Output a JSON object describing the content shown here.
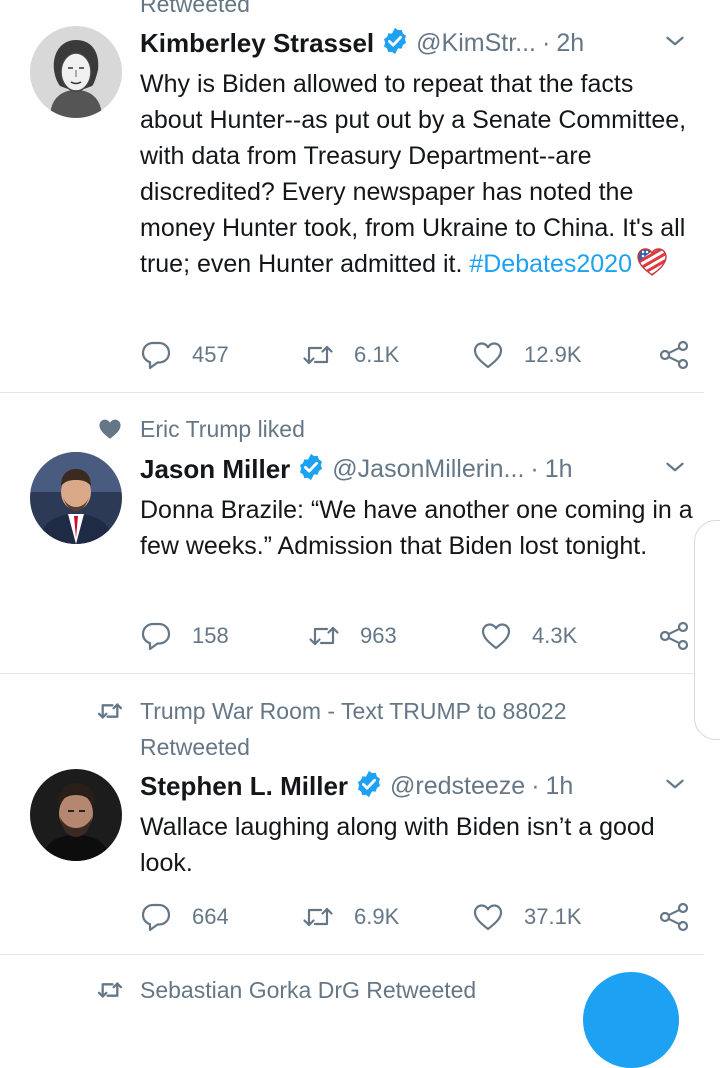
{
  "tweets": [
    {
      "social_context": "",
      "social_context_line2": "Retweeted",
      "name": "Kimberley Strassel",
      "handle": "@KimStr...",
      "time": "2h",
      "text": "Why is Biden allowed to repeat that the facts about Hunter--as put out by a Senate Committee, with data from Treasury Department--are discredited? Every newspaper has noted the money Hunter took, from Ukraine to China. It's all true; even Hunter admitted it.",
      "hashtag": "#Debates2020",
      "replies": "457",
      "retweets": "6.1K",
      "likes": "12.9K"
    },
    {
      "social_context": "Eric Trump liked",
      "name": "Jason Miller",
      "handle": "@JasonMillerin...",
      "time": "1h",
      "text": "Donna Brazile: “We have another one coming in a few weeks.” Admission that Biden lost tonight.",
      "replies": "158",
      "retweets": "963",
      "likes": "4.3K"
    },
    {
      "social_context": "Trump War Room - Text TRUMP to 88022",
      "social_context_line2": "Retweeted",
      "name": "Stephen L. Miller",
      "handle": "@redsteeze",
      "time": "1h",
      "text": "Wallace laughing along with Biden isn’t a good look.",
      "replies": "664",
      "retweets": "6.9K",
      "likes": "37.1K"
    },
    {
      "social_context": "Sebastian Gorka DrG Retweeted"
    }
  ],
  "separator": "·",
  "icons": {
    "verified": "verified-badge-icon",
    "caret": "chevron-down-icon",
    "reply": "reply-icon",
    "retweet": "retweet-icon",
    "like": "heart-icon",
    "share": "share-icon",
    "emoji": "flag-heart-emoji"
  },
  "colors": {
    "accent": "#1da1f2",
    "muted": "#657786",
    "text": "#14171a",
    "divider": "#e1e8ed"
  }
}
